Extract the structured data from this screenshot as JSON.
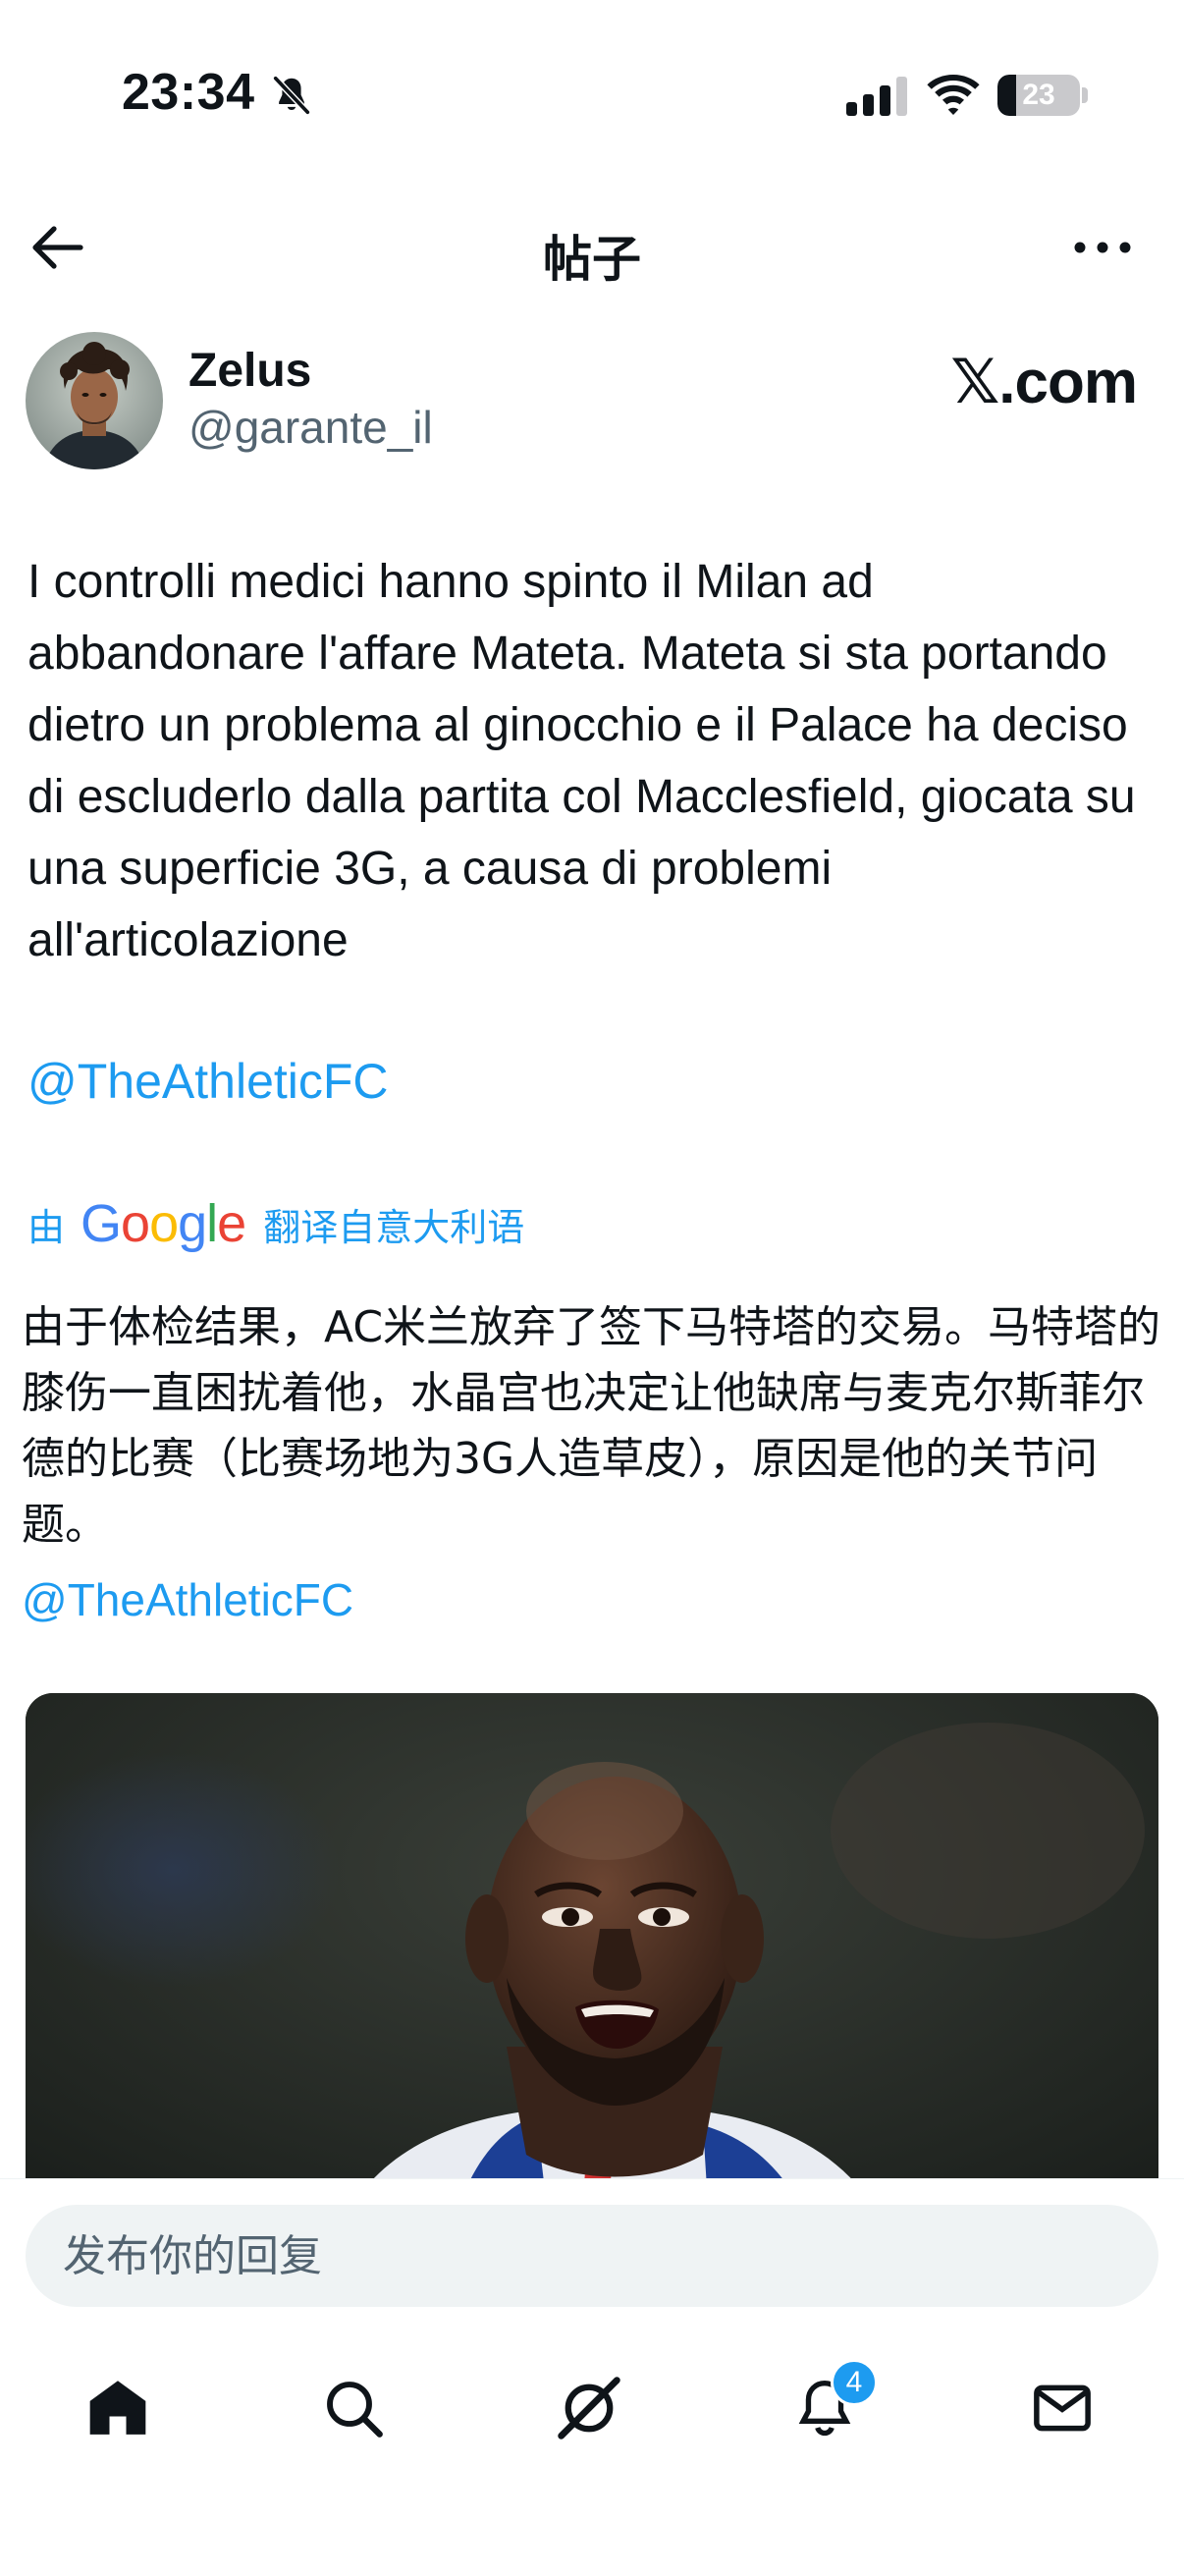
{
  "status_bar": {
    "time": "23:34",
    "battery_level": "23",
    "battery_fraction": 0.23,
    "icons": [
      "bell-muted-icon",
      "signal-icon",
      "wifi-icon",
      "battery-icon"
    ]
  },
  "header": {
    "title": "帖子",
    "back_icon": "arrow-left-icon",
    "more_icon": "more-horizontal-icon"
  },
  "post": {
    "author": {
      "name": "Zelus",
      "handle": "@garante_il"
    },
    "source": "𝕏.com",
    "text": "I controlli medici hanno spinto il Milan ad abbandonare l'affare Mateta. Mateta si sta portando dietro un problema al ginocchio e il Palace ha deciso di escluderlo dalla partita col Macclesfield, giocata su una superficie 3G, a causa di problemi all'articolazione",
    "mention": "@TheAthleticFC",
    "translation": {
      "by_label": "由",
      "provider": "Google",
      "language_label": "翻译自意大利语",
      "text": "由于体检结果，AC米兰放弃了签下马特塔的交易。马特塔的膝伤一直困扰着他，水晶宫也决定让他缺席与麦克尔斯菲尔德的比赛（比赛场地为3G人造草皮），原因是他的关节问题。",
      "mention": "@TheAthleticFC"
    }
  },
  "reply": {
    "placeholder": "发布你的回复"
  },
  "tab_bar": {
    "tabs": [
      {
        "name": "home",
        "icon": "home-icon"
      },
      {
        "name": "search",
        "icon": "search-icon"
      },
      {
        "name": "grok",
        "icon": "grok-icon"
      },
      {
        "name": "notifications",
        "icon": "bell-icon",
        "badge": "4"
      },
      {
        "name": "messages",
        "icon": "mail-icon"
      }
    ]
  },
  "colors": {
    "accent": "#1d9bf0",
    "text": "#0f1419",
    "secondary_text": "#536471",
    "input_bg": "#eff3f4"
  }
}
